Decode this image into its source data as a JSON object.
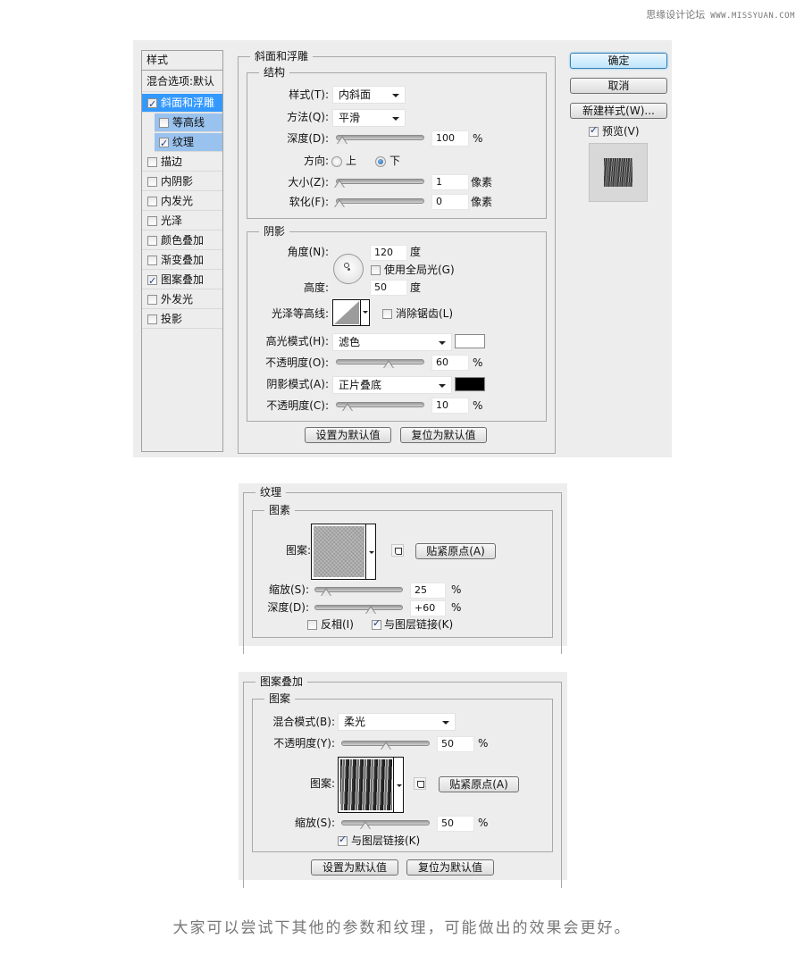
{
  "watermark": {
    "site": "思缘设计论坛",
    "url": "WWW.MISSYUAN.COM"
  },
  "dialog1": {
    "sidebar": {
      "header": "样式",
      "blending": "混合选项:默认",
      "items": [
        {
          "label": "斜面和浮雕",
          "checked": true,
          "state": "selected"
        },
        {
          "label": "等高线",
          "checked": false,
          "state": "sub"
        },
        {
          "label": "纹理",
          "checked": true,
          "state": "sub-selected"
        },
        {
          "label": "描边",
          "checked": false
        },
        {
          "label": "内阴影",
          "checked": false
        },
        {
          "label": "内发光",
          "checked": false
        },
        {
          "label": "光泽",
          "checked": false
        },
        {
          "label": "颜色叠加",
          "checked": false
        },
        {
          "label": "渐变叠加",
          "checked": false
        },
        {
          "label": "图案叠加",
          "checked": true
        },
        {
          "label": "外发光",
          "checked": false
        },
        {
          "label": "投影",
          "checked": false
        }
      ]
    },
    "section_title": "斜面和浮雕",
    "structure": {
      "title": "结构",
      "style_label": "样式(T):",
      "style_value": "内斜面",
      "technique_label": "方法(Q):",
      "technique_value": "平滑",
      "depth_label": "深度(D):",
      "depth_value": "100",
      "depth_unit": "%",
      "depth_slider_pct": 3,
      "direction_label": "方向:",
      "direction_up": "上",
      "direction_down": "下",
      "direction_selected": "下",
      "size_label": "大小(Z):",
      "size_value": "1",
      "size_unit": "像素",
      "size_slider_pct": 0,
      "soften_label": "软化(F):",
      "soften_value": "0",
      "soften_unit": "像素",
      "soften_slider_pct": 0
    },
    "shading": {
      "title": "阴影",
      "angle_label": "角度(N):",
      "angle_value": "120",
      "angle_unit": "度",
      "global_light_label": "使用全局光(G)",
      "global_light_checked": false,
      "altitude_label": "高度:",
      "altitude_value": "50",
      "altitude_unit": "度",
      "gloss_contour_label": "光泽等高线:",
      "antialias_label": "消除锯齿(L)",
      "antialias_checked": false,
      "highlight_mode_label": "高光模式(H):",
      "highlight_mode_value": "滤色",
      "highlight_color": "#ffffff",
      "highlight_opacity_label": "不透明度(O):",
      "highlight_opacity_value": "60",
      "highlight_opacity_unit": "%",
      "highlight_opacity_pct": 60,
      "shadow_mode_label": "阴影模式(A):",
      "shadow_mode_value": "正片叠底",
      "shadow_color": "#000000",
      "shadow_opacity_label": "不透明度(C):",
      "shadow_opacity_value": "10",
      "shadow_opacity_unit": "%",
      "shadow_opacity_pct": 10
    },
    "buttons": {
      "make_default": "设置为默认值",
      "reset_default": "复位为默认值"
    },
    "right": {
      "ok": "确定",
      "cancel": "取消",
      "new_style": "新建样式(W)...",
      "preview_label": "预览(V)",
      "preview_checked": true
    }
  },
  "dialog2": {
    "section_title": "纹理",
    "group_title": "图素",
    "pattern_label": "图案:",
    "snap_button": "贴紧原点(A)",
    "scale_label": "缩放(S):",
    "scale_value": "25",
    "scale_unit": "%",
    "scale_pct": 10,
    "depth_label": "深度(D):",
    "depth_value": "+60",
    "depth_unit": "%",
    "depth_pct": 65,
    "invert_label": "反相(I)",
    "invert_checked": false,
    "link_label": "与图层链接(K)",
    "link_checked": true
  },
  "dialog3": {
    "section_title": "图案叠加",
    "group_title": "图案",
    "blend_label": "混合模式(B):",
    "blend_value": "柔光",
    "opacity_label": "不透明度(Y):",
    "opacity_value": "50",
    "opacity_unit": "%",
    "opacity_pct": 50,
    "pattern_label": "图案:",
    "snap_button": "贴紧原点(A)",
    "scale_label": "缩放(S):",
    "scale_value": "50",
    "scale_unit": "%",
    "scale_pct": 25,
    "link_label": "与图层链接(K)",
    "link_checked": true,
    "buttons": {
      "make_default": "设置为默认值",
      "reset_default": "复位为默认值"
    }
  },
  "caption": "大家可以尝试下其他的参数和纹理，可能做出的效果会更好。"
}
